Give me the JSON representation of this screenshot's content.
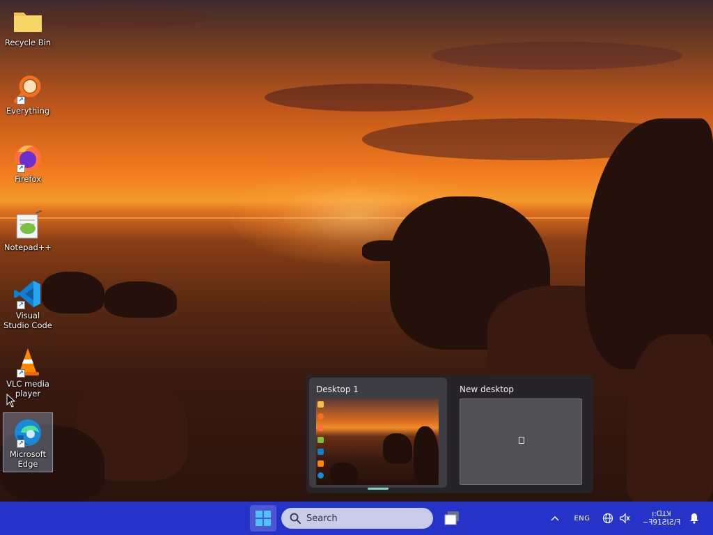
{
  "desktop": {
    "icons": [
      {
        "label": "Recycle Bin",
        "icon": "folder-icon"
      },
      {
        "label": "Everything",
        "icon": "magnifier-icon"
      },
      {
        "label": "Firefox",
        "icon": "firefox-icon"
      },
      {
        "label": "Notepad++",
        "icon": "notepad-plus-plus-icon"
      },
      {
        "label": "Visual Studio Code",
        "icon": "vscode-icon"
      },
      {
        "label": "VLC media player",
        "icon": "vlc-cone-icon"
      },
      {
        "label": "Microsoft Edge",
        "icon": "edge-icon"
      }
    ],
    "selected_icon": "Microsoft Edge"
  },
  "task_view": {
    "desktops": [
      {
        "title": "Desktop 1",
        "active": true
      },
      {
        "title": "New desktop",
        "active": false
      }
    ],
    "active_indicator_color": "#7fd3c4"
  },
  "taskbar": {
    "color": "#2633c9",
    "search": {
      "placeholder": "Search"
    },
    "tray": {
      "language": "ENG",
      "clock_line1": "ᴉ:ᗡꓕꞰ",
      "clock_line2": "~ꟻ91ƧƖ​Ƨ/ꟻ"
    }
  }
}
